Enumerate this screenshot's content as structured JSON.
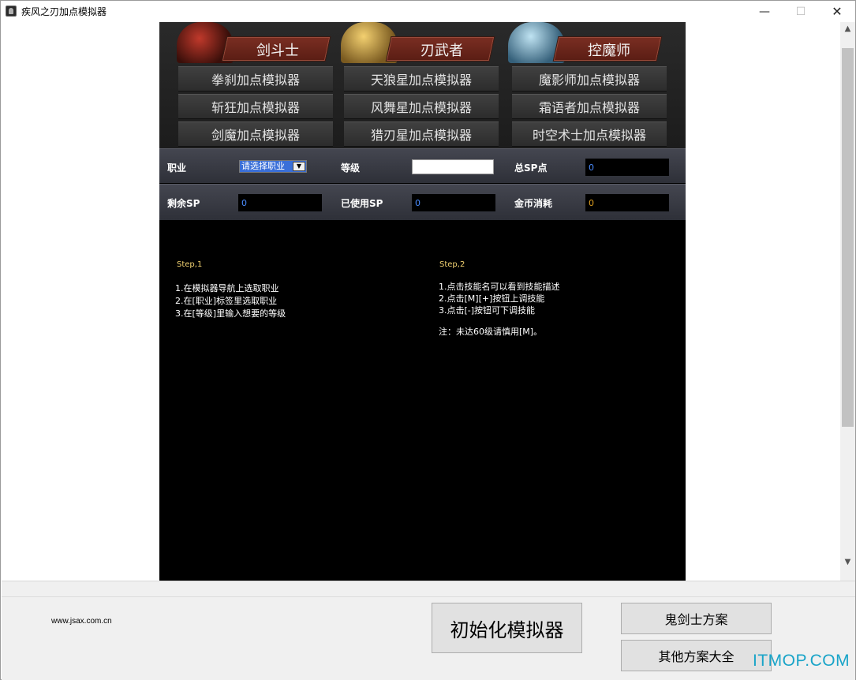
{
  "window": {
    "title": "疾风之刃加点模拟器",
    "minimize_glyph": "—",
    "maximize_glyph": "☐",
    "close_glyph": "✕"
  },
  "classes": [
    {
      "name": "剑斗士",
      "color": "#c0392b",
      "sims": [
        "拳刹加点模拟器",
        "斩狂加点模拟器",
        "剑魔加点模拟器"
      ]
    },
    {
      "name": "刃武者",
      "color": "#e0b040",
      "sims": [
        "天狼星加点模拟器",
        "风舞星加点模拟器",
        "猎刃星加点模拟器"
      ]
    },
    {
      "name": "控魔师",
      "color": "#7fb8d8",
      "sims": [
        "魔影师加点模拟器",
        "霜语者加点模拟器",
        "时空术士加点模拟器"
      ]
    }
  ],
  "stats": {
    "job_label": "职业",
    "job_select_value": "请选择职业",
    "level_label": "等级",
    "level_value": "",
    "total_sp_label": "总SP点",
    "total_sp_value": "0",
    "remaining_sp_label": "剩余SP",
    "remaining_sp_value": "0",
    "used_sp_label": "已使用SP",
    "used_sp_value": "0",
    "gold_label": "金币消耗",
    "gold_value": "0"
  },
  "steps": {
    "step1_title": "Step,1",
    "step1_lines": [
      "1.在模拟器导航上选取职业",
      "2.在[职业]标签里选取职业",
      "3.在[等级]里输入想要的等级"
    ],
    "step2_title": "Step,2",
    "step2_lines": [
      "1.点击技能名可以看到技能描述",
      "2.点击[M][+]按钮上调技能",
      "3.点击[-]按钮可下调技能"
    ],
    "step2_note": "注：未达60级请慎用[M]。"
  },
  "bottom": {
    "site": "www.jsax.com.cn",
    "init_button": "初始化模拟器",
    "ghost_button": "鬼剑士方案",
    "other_button": "其他方案大全",
    "watermark": "ITMOP.COM"
  }
}
